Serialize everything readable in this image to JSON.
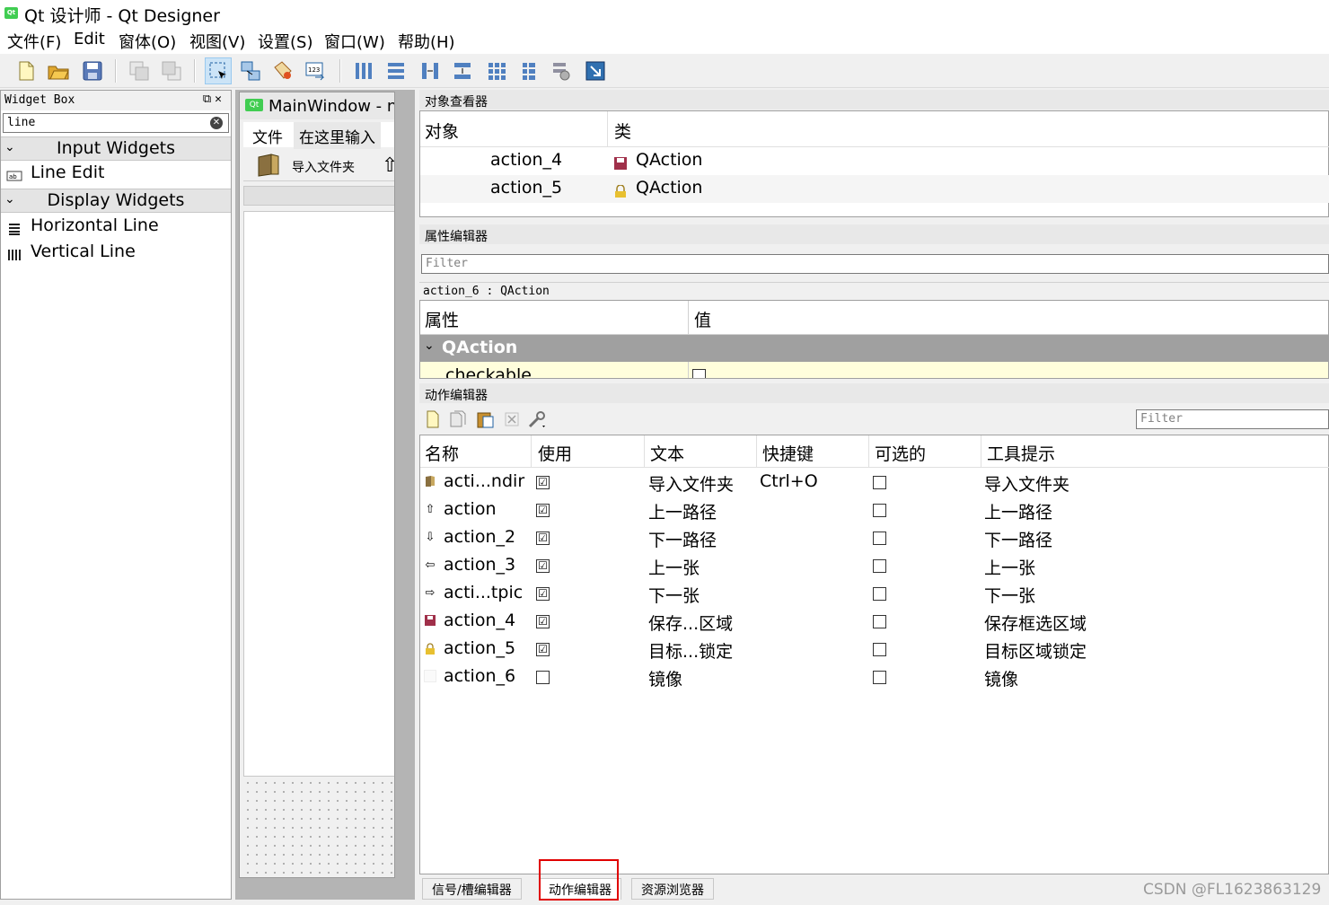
{
  "window": {
    "title": "Qt 设计师 - Qt Designer",
    "app_icon_text": "Qt"
  },
  "menubar": [
    "文件(F)",
    "Edit",
    "窗体(O)",
    "视图(V)",
    "设置(S)",
    "窗口(W)",
    "帮助(H)"
  ],
  "toolbar": [
    "new-icon",
    "open-icon",
    "save-icon",
    "bring-front-icon",
    "send-back-icon",
    "edit-widgets-icon",
    "edit-signals-icon",
    "edit-buddies-icon",
    "edit-tab-order-icon",
    "layout-horizontal-icon",
    "layout-vertical-icon",
    "layout-h-splitter-icon",
    "layout-v-splitter-icon",
    "layout-grid-icon",
    "layout-form-icon",
    "break-layout-icon",
    "adjust-size-icon"
  ],
  "widget_box": {
    "title": "Widget Box",
    "search_value": "line",
    "categories": [
      {
        "label": "Input Widgets",
        "items": [
          {
            "label": "Line Edit",
            "icon": "line-edit-icon"
          }
        ]
      },
      {
        "label": "Display Widgets",
        "items": [
          {
            "label": "Horizontal Line",
            "icon": "horizontal-line-icon"
          },
          {
            "label": "Vertical Line",
            "icon": "vertical-line-icon"
          }
        ]
      }
    ]
  },
  "form_window": {
    "icon_text": "Qt",
    "title": "MainWindow - n",
    "menu_items": [
      "文件",
      "在这里输入"
    ],
    "toolbar_label": "导入文件夹"
  },
  "object_inspector": {
    "title": "对象查看器",
    "headers": [
      "对象",
      "类"
    ],
    "rows": [
      {
        "name": "action_4",
        "class": "QAction",
        "icon": "save-icon"
      },
      {
        "name": "action_5",
        "class": "QAction",
        "icon": "lock-icon"
      }
    ]
  },
  "property_editor": {
    "title": "属性编辑器",
    "filter_placeholder": "Filter",
    "object_label": "action_6 : QAction",
    "headers": [
      "属性",
      "值"
    ],
    "group": "QAction",
    "row": {
      "name": "checkable",
      "checked": false
    }
  },
  "action_editor": {
    "title": "动作编辑器",
    "filter_placeholder": "Filter",
    "toolbar": [
      "new-action-icon",
      "copy-action-icon",
      "paste-action-icon",
      "delete-action-icon",
      "configure-icon"
    ],
    "headers": [
      "名称",
      "使用",
      "文本",
      "快捷键",
      "可选的",
      "工具提示"
    ],
    "rows": [
      {
        "name": "acti...ndir",
        "used": "☑",
        "text": "导入文件夹",
        "shortcut": "Ctrl+O",
        "checkable": "",
        "tooltip": "导入文件夹",
        "icon": "folder-icon"
      },
      {
        "name": "action",
        "used": "☑",
        "text": "上一路径",
        "shortcut": "",
        "checkable": "",
        "tooltip": "上一路径",
        "icon": "arrow-up-icon"
      },
      {
        "name": "action_2",
        "used": "☑",
        "text": "下一路径",
        "shortcut": "",
        "checkable": "",
        "tooltip": "下一路径",
        "icon": "arrow-down-icon"
      },
      {
        "name": "action_3",
        "used": "☑",
        "text": "上一张",
        "shortcut": "",
        "checkable": "",
        "tooltip": "上一张",
        "icon": "arrow-left-icon"
      },
      {
        "name": "acti...tpic",
        "used": "☑",
        "text": "下一张",
        "shortcut": "",
        "checkable": "",
        "tooltip": "下一张",
        "icon": "arrow-right-icon"
      },
      {
        "name": "action_4",
        "used": "☑",
        "text": "保存...区域",
        "shortcut": "",
        "checkable": "",
        "tooltip": "保存框选区域",
        "icon": "save-icon"
      },
      {
        "name": "action_5",
        "used": "☑",
        "text": "目标...锁定",
        "shortcut": "",
        "checkable": "",
        "tooltip": "目标区域锁定",
        "icon": "lock-icon"
      },
      {
        "name": "action_6",
        "used": "",
        "text": "镜像",
        "shortcut": "",
        "checkable": "",
        "tooltip": "镜像",
        "icon": "blank-icon"
      }
    ]
  },
  "bottom_tabs": [
    {
      "label": "信号/槽编辑器",
      "selected": false
    },
    {
      "label": "动作编辑器",
      "selected": true
    },
    {
      "label": "资源浏览器",
      "selected": false
    }
  ],
  "watermark": "CSDN @FL1623863129",
  "colors": {
    "highlight_box": "#e00000",
    "group_header": "#a0a0a0",
    "selected_row": "#fffedc"
  }
}
